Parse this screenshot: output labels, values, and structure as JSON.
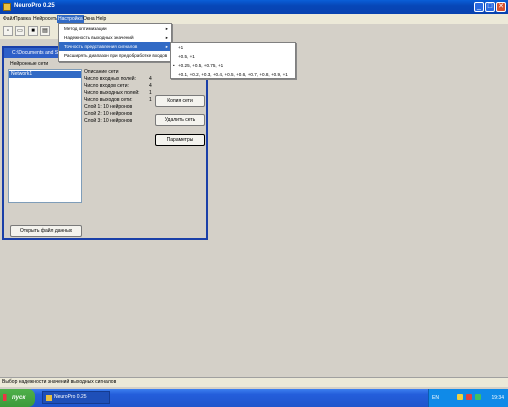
{
  "window": {
    "title": "NeuroPro 0.25",
    "min": "_",
    "max": "□",
    "close": "✕"
  },
  "menubar": {
    "items": [
      "Файл",
      "Правка",
      "Нейросеть",
      "Настройка",
      "Окна",
      "Help"
    ]
  },
  "settings_menu": {
    "items": [
      {
        "label": "Метод оптимизации",
        "arrow": "▸"
      },
      {
        "label": "Надежность выходных значений",
        "arrow": "▸"
      },
      {
        "label": "Точность представления сигналов",
        "arrow": "▸"
      },
      {
        "label": "Расширять диапазон при предобработке входов",
        "arrow": ""
      }
    ]
  },
  "submenu": {
    "items": [
      {
        "label": "+1",
        "bullet": ""
      },
      {
        "label": "+0.5, +1",
        "bullet": ""
      },
      {
        "label": "+0.25, +0.5, +0.75, +1",
        "bullet": "•"
      },
      {
        "label": "+0.1, +0.2, +0.3, +0.4, +0.5, +0.6, +0.7, +0.8, +0.9, +1",
        "bullet": ""
      }
    ]
  },
  "child_window": {
    "title": "C:\\Documents and S",
    "list_label": "Нейронные сети",
    "networks": [
      "Network1"
    ],
    "open_button": "Открыть файл данных"
  },
  "net_info": {
    "header": "Описание сети",
    "rows": [
      {
        "label": "Число входных полей:",
        "value": "4"
      },
      {
        "label": "Число входов сети:",
        "value": "4"
      },
      {
        "label": "Число выходных полей:",
        "value": "1"
      },
      {
        "label": "Число выходов сети:",
        "value": "1"
      },
      {
        "label": "Слой 1:  10 нейронов",
        "value": ""
      },
      {
        "label": "Слой 2:  10 нейронов",
        "value": ""
      },
      {
        "label": "Слой 3:  10 нейронов",
        "value": ""
      }
    ]
  },
  "buttons": {
    "copy": "Копия сети",
    "delete": "Удалить сеть",
    "params": "Параметры"
  },
  "statusbar": {
    "text": "Выбор надежности значений выходных сигналов"
  },
  "taskbar": {
    "start": "пуск",
    "task": "NeuroPro 0.25",
    "lang": "EN",
    "clock": "19:34"
  }
}
